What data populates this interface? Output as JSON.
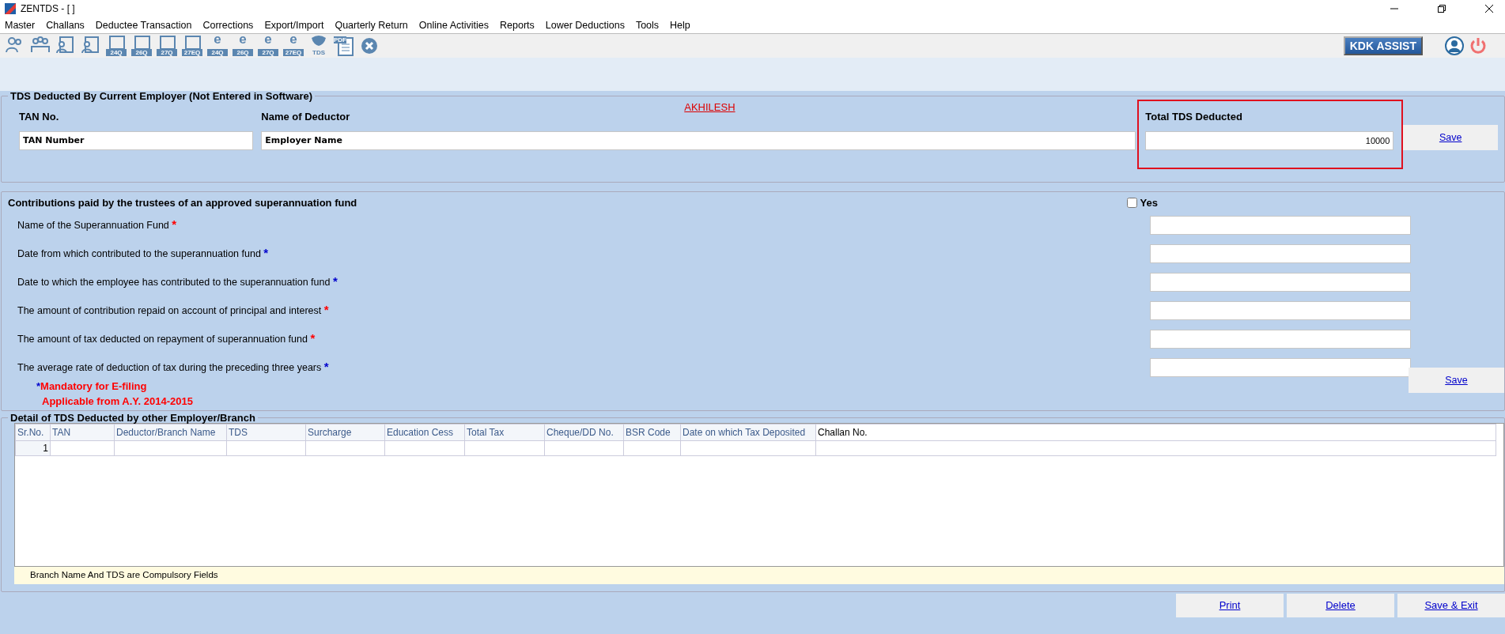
{
  "window": {
    "title": "ZENTDS - [ ]"
  },
  "menu": [
    "Master",
    "Challans",
    "Deductee Transaction",
    "Corrections",
    "Export/Import",
    "Quarterly Return",
    "Online Activities",
    "Reports",
    "Lower Deductions",
    "Tools",
    "Help"
  ],
  "toolbar": [
    {
      "kind": "person"
    },
    {
      "kind": "group"
    },
    {
      "kind": "card"
    },
    {
      "kind": "card"
    },
    {
      "kind": "form",
      "label": "24Q"
    },
    {
      "kind": "form",
      "label": "26Q"
    },
    {
      "kind": "form",
      "label": "27Q"
    },
    {
      "kind": "form",
      "label": "27EQ"
    },
    {
      "kind": "efile",
      "glyph": "e",
      "label": "24Q"
    },
    {
      "kind": "efile",
      "glyph": "e",
      "label": "26Q"
    },
    {
      "kind": "efile",
      "glyph": "e",
      "label": "27Q"
    },
    {
      "kind": "efile",
      "glyph": "e",
      "label": "27EQ"
    },
    {
      "kind": "tds",
      "label": "TDS"
    },
    {
      "kind": "pdf",
      "label": "PDF"
    },
    {
      "kind": "close"
    }
  ],
  "assist_button": "KDK ASSIST",
  "current_employer": {
    "title": "TDS Deducted By Current Employer (Not Entered in Software)",
    "tan_label": "TAN No.",
    "tan_value": "TAN Number",
    "deductor_label": "Name of Deductor",
    "deductor_value": "Employer Name",
    "link": "AKHILESH",
    "total_label": "Total TDS Deducted",
    "total_value": "10000",
    "highlighted": true,
    "save": "Save"
  },
  "superannuation": {
    "title": "Contributions paid by the trustees of an approved superannuation fund",
    "yes_label": "Yes",
    "yes_checked": false,
    "fields": [
      {
        "label": "Name of the Superannuation Fund",
        "color": "#ff0000"
      },
      {
        "label": "Date from which contributed to the superannuation fund",
        "color": "#0000cc"
      },
      {
        "label": "Date to which the employee has contributed to the superannuation fund",
        "color": "#0000cc"
      },
      {
        "label": "The amount of contribution repaid on account of principal and interest",
        "color": "#ff0000"
      },
      {
        "label": "The amount of tax deducted on repayment of superannuation fund",
        "color": "#ff0000"
      },
      {
        "label": "The average rate of deduction of tax during the preceding three years",
        "color": "#0000cc"
      }
    ],
    "note_mark": "*",
    "note_line1": "Mandatory for E-filing",
    "note_line2": "Applicable from A.Y. 2014-2015",
    "save": "Save"
  },
  "other_employer": {
    "title": "Detail of TDS Deducted by other Employer/Branch",
    "table": {
      "columns": [
        "Sr.No.",
        "TAN",
        "Deductor/Branch Name",
        "TDS",
        "Surcharge",
        "Education Cess",
        "Total Tax",
        "Cheque/DD No.",
        "BSR Code",
        "Date on which Tax Deposited",
        "Challan No."
      ],
      "rows": [
        [
          "1",
          "",
          "",
          "",
          "",
          "",
          "",
          "",
          "",
          "",
          ""
        ]
      ]
    },
    "footer_note": "Branch Name And TDS are Compulsory Fields"
  },
  "buttons": [
    "Print",
    "Delete",
    "Save & Exit"
  ]
}
